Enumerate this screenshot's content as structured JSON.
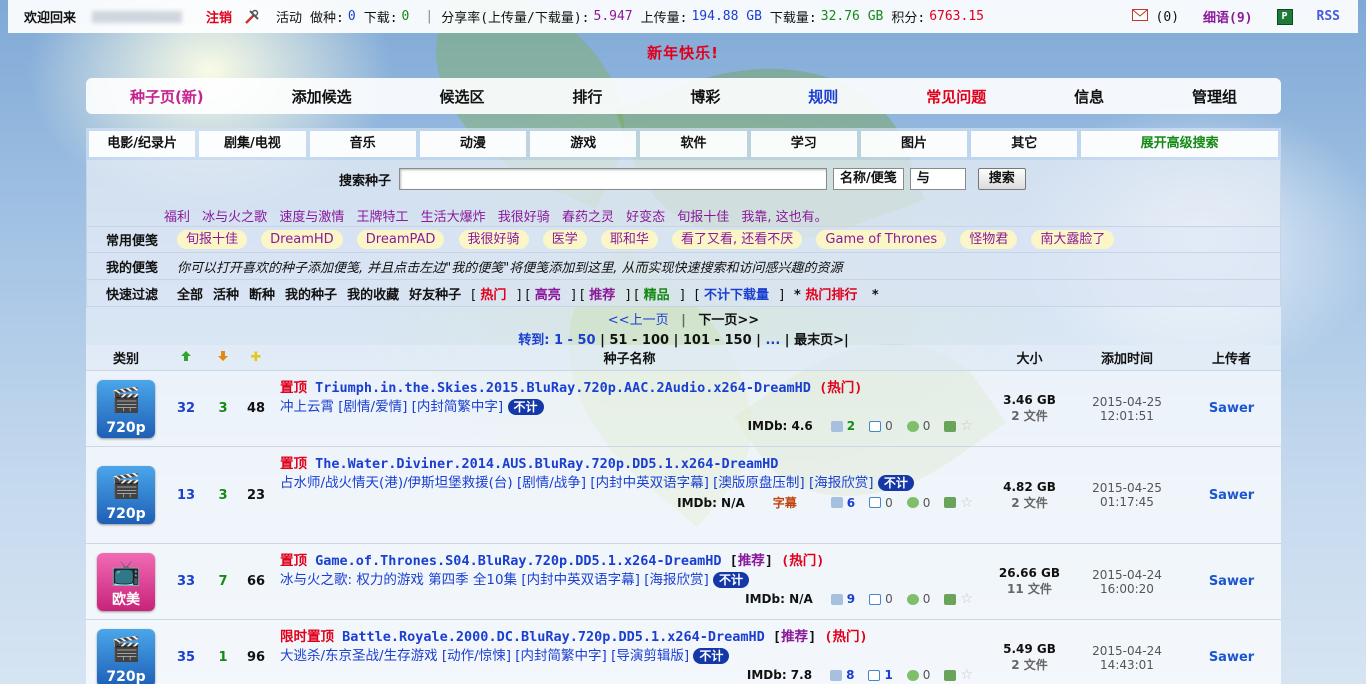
{
  "topbar": {
    "welcome": "欢迎回来",
    "logout": "注销",
    "activity_label": "活动",
    "seeding_label": "做种:",
    "seeding": "0",
    "downloading_label": "下载:",
    "downloading": "0",
    "ratio_label": "分享率(上传量/下载量):",
    "ratio": "5.947",
    "upload_label": "上传量:",
    "upload": "194.88 GB",
    "download_label": "下载量:",
    "download": "32.76 GB",
    "bonus_label": "积分:",
    "bonus": "6763.15",
    "mail": "(0)",
    "whisper": "细语(9)",
    "rss": "RSS"
  },
  "banner": "新年快乐!",
  "nav": [
    "种子页(新)",
    "添加候选",
    "候选区",
    "排行",
    "博彩",
    "规则",
    "常见问题",
    "信息",
    "管理组"
  ],
  "categories": [
    "电影/纪录片",
    "剧集/电视",
    "音乐",
    "动漫",
    "游戏",
    "软件",
    "学习",
    "图片",
    "其它",
    "展开高级搜索"
  ],
  "search": {
    "label": "搜索种子",
    "value": "",
    "scope": "名称/便笺",
    "mode": "与",
    "button": "搜索",
    "hot_keywords": [
      "福利",
      "冰与火之歌",
      "速度与激情",
      "王牌特工",
      "生活大爆炸",
      "我很好骑",
      "春药之灵",
      "好变态",
      "旬报十佳",
      "我靠, 这也有。"
    ]
  },
  "common_tags": {
    "label": "常用便笺",
    "items": [
      "旬报十佳",
      "DreamHD",
      "DreamPAD",
      "我很好骑",
      "医学",
      "耶和华",
      "看了又看, 还看不厌",
      "Game of Thrones",
      "怪物君",
      "南大露脸了"
    ]
  },
  "my_tags": {
    "label": "我的便笺",
    "text": "你可以打开喜欢的种子添加便笺, 并且点击左边\"我的便笺\"将便笺添加到这里, 从而实现快速搜索和访问感兴趣的资源"
  },
  "quick_filter": {
    "label": "快速过滤",
    "items": [
      "全部",
      "活种",
      "断种",
      "我的种子",
      "我的收藏",
      "好友种子"
    ],
    "hot": "热门",
    "highlight": "高亮",
    "recommend": "推荐",
    "fine": "精品",
    "free": "不计下载量",
    "rank": "热门排行"
  },
  "pager": {
    "prev": "<<上一页",
    "next": "下一页>>",
    "goto": "转到:",
    "ranges": [
      "1 - 50",
      "51 - 100",
      "101 - 150",
      "...",
      "最末页>|"
    ]
  },
  "table": {
    "headers": {
      "cat": "类别",
      "name": "种子名称",
      "size": "大小",
      "time": "添加时间",
      "uploader": "上传者"
    },
    "rows": [
      {
        "cat": "720p",
        "seeders": "32",
        "leechers": "3",
        "finished": "48",
        "pin": "置顶",
        "title": "Triumph.in.the.Skies.2015.BluRay.720p.AAC.2Audio.x264-DreamHD",
        "rec": "",
        "hot": "(热门)",
        "desc": "冲上云霄 [剧情/爱情] [内封简繁中字]",
        "free": "不计",
        "imdb": "IMDb: 4.6",
        "subtitle": "",
        "thumbs": "2",
        "comments": "0",
        "talk": "0",
        "size": "3.46 GB",
        "files": "2 文件",
        "date": "2015-04-25",
        "time": "12:01:51",
        "uploader": "Sawer"
      },
      {
        "cat": "720p",
        "seeders": "13",
        "leechers": "3",
        "finished": "23",
        "pin": "置顶",
        "title": "The.Water.Diviner.2014.AUS.BluRay.720p.DD5.1.x264-DreamHD",
        "rec": "",
        "hot": "",
        "desc": "占水师/战火情天(港)/伊斯坦堡救援(台) [剧情/战争] [内封中英双语字幕] [澳版原盘压制] [海报欣赏]",
        "free": "不计",
        "imdb": "IMDb: N/A",
        "subtitle": "字幕",
        "thumbs": "6",
        "comments": "0",
        "talk": "0",
        "size": "4.82 GB",
        "files": "2 文件",
        "date": "2015-04-25",
        "time": "01:17:45",
        "uploader": "Sawer"
      },
      {
        "cat": "欧美",
        "seeders": "33",
        "leechers": "7",
        "finished": "66",
        "pin": "置顶",
        "title": "Game.of.Thrones.S04.BluRay.720p.DD5.1.x264-DreamHD",
        "rec": "推荐",
        "hot": "(热门)",
        "desc": "冰与火之歌: 权力的游戏 第四季 全10集 [内封中英双语字幕] [海报欣赏]",
        "free": "不计",
        "imdb": "IMDb: N/A",
        "subtitle": "",
        "thumbs": "9",
        "comments": "0",
        "talk": "0",
        "size": "26.66 GB",
        "files": "11 文件",
        "date": "2015-04-24",
        "time": "16:00:20",
        "uploader": "Sawer"
      },
      {
        "cat": "720p",
        "seeders": "35",
        "leechers": "1",
        "finished": "96",
        "pin": "限时置顶",
        "title": "Battle.Royale.2000.DC.BluRay.720p.DD5.1.x264-DreamHD",
        "rec": "推荐",
        "hot": "(热门)",
        "desc": "大逃杀/东京圣战/生存游戏 [动作/惊悚] [内封简繁中字] [导演剪辑版]",
        "free": "不计",
        "imdb": "IMDb: 7.8",
        "subtitle": "",
        "thumbs": "8",
        "comments": "1",
        "talk": "0",
        "size": "5.49 GB",
        "files": "2 文件",
        "date": "2015-04-24",
        "time": "14:43:01",
        "uploader": "Sawer"
      }
    ]
  },
  "colors": {
    "red": "#e0001b",
    "blue": "#1a3fd1",
    "green": "#158a15",
    "purple": "#8a1a9a"
  }
}
